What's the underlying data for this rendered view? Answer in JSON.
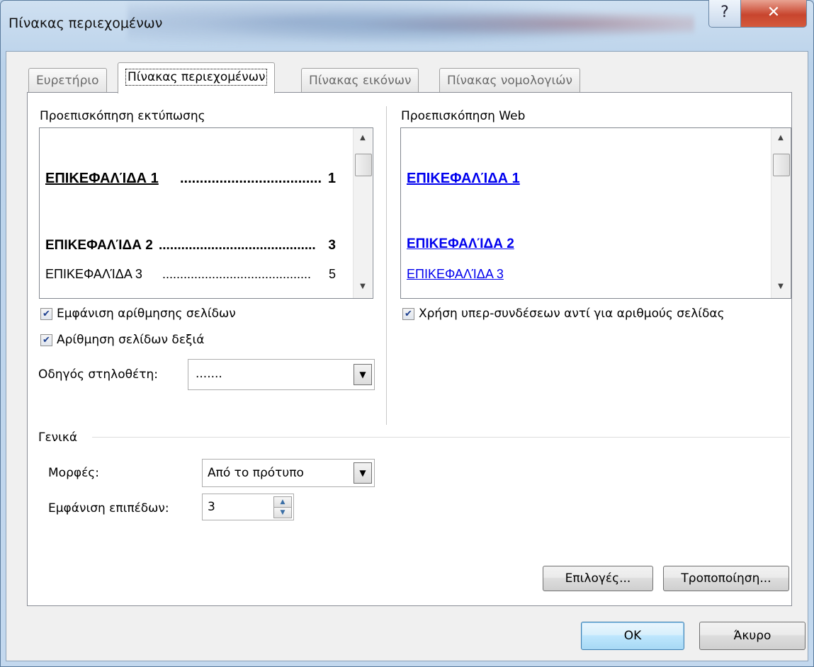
{
  "window": {
    "title": "Πίνακας περιεχομένων",
    "help_glyph": "?",
    "close_glyph": "✕"
  },
  "tabs": [
    {
      "label": "Ευρετήριο",
      "active": false
    },
    {
      "label": "Πίνακας περιεχομένων",
      "active": true
    },
    {
      "label": "Πίνακας εικόνων",
      "active": false
    },
    {
      "label": "Πίνακας νομολογιών",
      "active": false
    }
  ],
  "print_preview": {
    "label": "Προεπισκόπηση εκτύπωσης",
    "entries": [
      {
        "text": "ΕΠΙΚΕΦΑΛΊΔΑ 1",
        "dots": "..........................................",
        "page": "1"
      },
      {
        "text": "ΕΠΙΚΕΦΑΛΊΔΑ 2",
        "dots": "..........................................",
        "page": "3"
      },
      {
        "text": "ΕΠΙΚΕΦΑΛΊΔΑ 3",
        "dots": "..........................................",
        "page": "5"
      }
    ]
  },
  "web_preview": {
    "label": "Προεπισκόπηση Web",
    "entries": [
      "ΕΠΙΚΕΦΑΛΊΔΑ 1",
      "ΕΠΙΚΕΦΑΛΊΔΑ 2",
      "ΕΠΙΚΕΦΑΛΊΔΑ 3"
    ]
  },
  "options": {
    "show_page_numbers": {
      "label": "Εμφάνιση αρίθμησης σελίδων",
      "checked": true
    },
    "right_align": {
      "label": "Αρίθμηση σελίδων δεξιά",
      "checked": true
    },
    "hyperlinks": {
      "label": "Χρήση υπερ-συνδέσεων αντί για αριθμούς σελίδας",
      "checked": true
    },
    "tab_leader": {
      "label": "Οδηγός στηλοθέτη:",
      "value": "......."
    }
  },
  "general": {
    "label": "Γενικά",
    "formats": {
      "label": "Μορφές:",
      "value": "Από το πρότυπο"
    },
    "levels": {
      "label": "Εμφάνιση επιπέδων:",
      "value": "3"
    }
  },
  "buttons": {
    "options": "Επιλογές...",
    "modify": "Τροποποίηση...",
    "ok": "OK",
    "cancel": "Άκυρο"
  },
  "colors": {
    "link": "#0000ee",
    "accent": "#3c7fb1"
  }
}
